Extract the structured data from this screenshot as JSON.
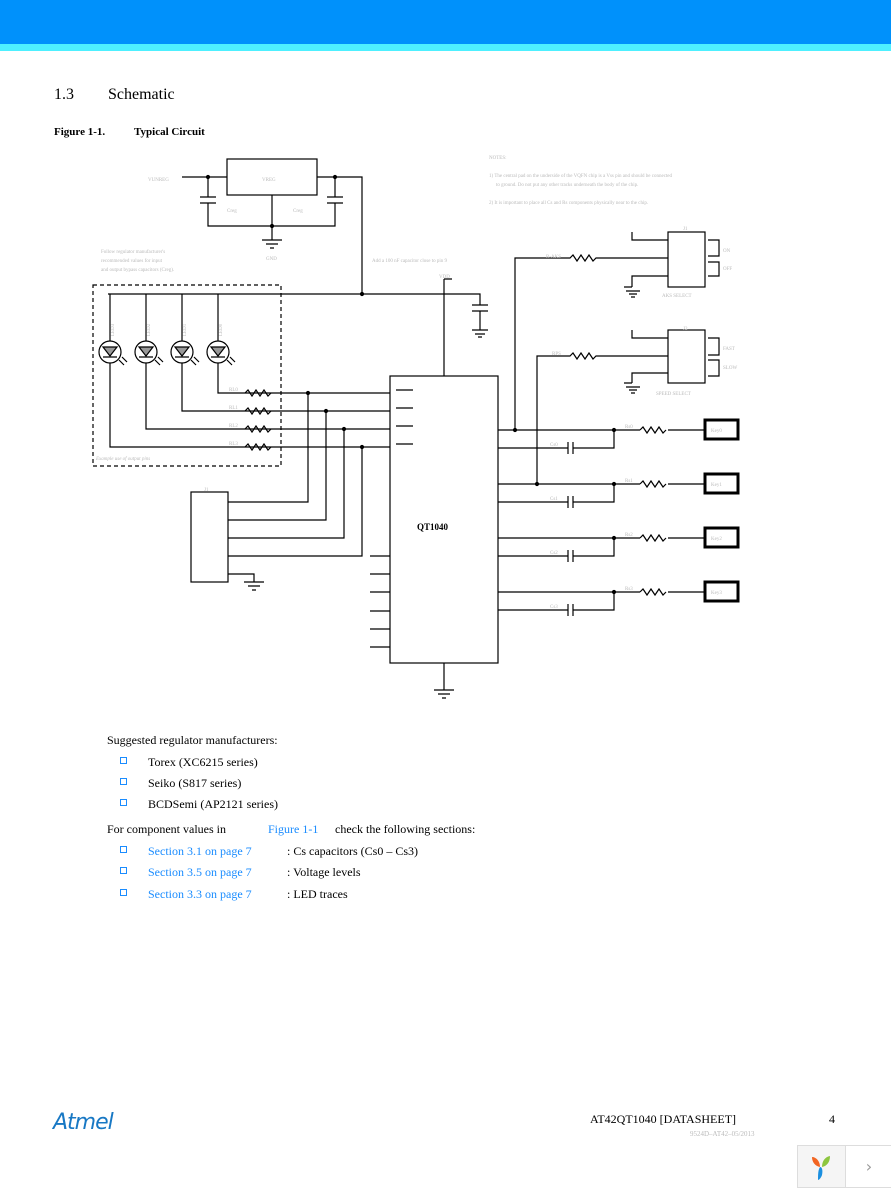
{
  "header": {
    "colors": {
      "bar": "#0091fb",
      "stripe": "#4ef0ff"
    }
  },
  "section": {
    "number": "1.3",
    "title": "Schematic"
  },
  "figure": {
    "label": "Figure 1-1.",
    "title": "Typical Circuit"
  },
  "schematic": {
    "vunreg": "VUNREG",
    "vreg": "VREG",
    "creg": "Creg",
    "gnd": "GND",
    "vdd": "VDD",
    "regulator_note": [
      "Follow regulator manufacturer's",
      "recommended values for input",
      "and output bypass capacitors (Creg)."
    ],
    "cap_note": "Add a 100 nF capacitor close to pin 9",
    "notes_title": "NOTES:",
    "notes": [
      "1) The central pad on the underside of the VQFN chip is a Vss pin and should be connected",
      "to ground. Do not put any other tracks underneath the body of the chip.",
      "2) It is important to place all Cs and Rs components physically near to the chip."
    ],
    "leds": [
      "LED3",
      "LED2",
      "LED1",
      "LED0"
    ],
    "led_resistors": [
      "RL0",
      "RL1",
      "RL2",
      "RL3"
    ],
    "led_box_caption": "Example use of output pins",
    "chip_name": "QT1040",
    "j1": "J1",
    "aks_resistor": "R-AKS",
    "aks_switch": {
      "ref": "J1",
      "on": "ON",
      "off": "OFF",
      "caption": "AKS SELECT"
    },
    "speed_resistor": "RPS",
    "speed_switch": {
      "ref": "J2",
      "fast": "FAST",
      "slow": "SLOW",
      "caption": "SPEED SELECT"
    },
    "sense_resistors": [
      "Rs0",
      "Rs1",
      "Rs2",
      "Rs3"
    ],
    "sense_caps": [
      "Cs0",
      "Cs1",
      "Cs2",
      "Cs3"
    ],
    "keys": [
      "Key0",
      "Key1",
      "Key2",
      "Key3"
    ]
  },
  "body": {
    "manufacturers_intro": "Suggested regulator manufacturers:",
    "manufacturers": [
      "Torex (XC6215 series)",
      "Seiko (S817 series)",
      "BCDSemi (AP2121 series)"
    ],
    "components_intro_before": "For component values in",
    "components_intro_link": "Figure 1-1",
    "components_intro_after": "check the following sections:",
    "sections": [
      {
        "link": "Section 3.1 on page 7",
        "desc": ": Cs capacitors (Cs0 – Cs3)"
      },
      {
        "link": "Section 3.5 on page 7",
        "desc": ": Voltage levels"
      },
      {
        "link": "Section 3.3 on page 7",
        "desc": ": LED traces"
      }
    ],
    "link_color": "#1a8cff"
  },
  "footer": {
    "logo": "Atmel",
    "doc_title": "AT42QT1040 [DATASHEET]",
    "page": "4",
    "doc_code": "9524D–AT42–05/2013"
  },
  "viewer_nav": {
    "next_icon": "chevron-right-icon"
  }
}
